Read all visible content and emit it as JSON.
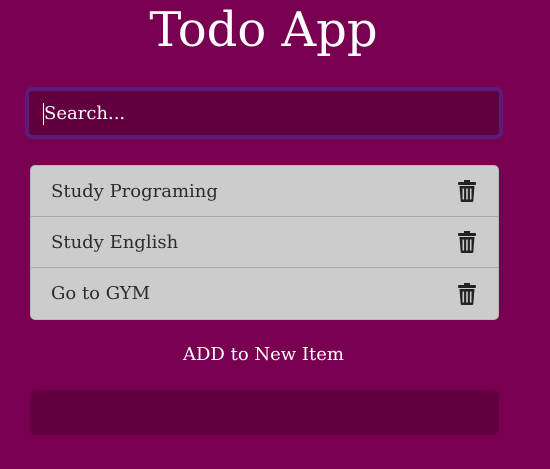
{
  "header": {
    "title": "Todo App"
  },
  "search": {
    "placeholder": "Search...",
    "value": ""
  },
  "todos": [
    {
      "text": "Study Programing",
      "action_icon": "trash-icon"
    },
    {
      "text": "Study English",
      "action_icon": "trash-icon"
    },
    {
      "text": "Go to GYM",
      "action_icon": "trash-icon"
    }
  ],
  "add_form": {
    "label": "ADD to New Item",
    "value": ""
  },
  "colors": {
    "background": "#790051",
    "input_background": "#62003f",
    "search_border": "#5a1c78",
    "list_background": "#cccccc",
    "list_text": "#2b2b2b",
    "icon": "#222222",
    "text": "#ffffff"
  }
}
